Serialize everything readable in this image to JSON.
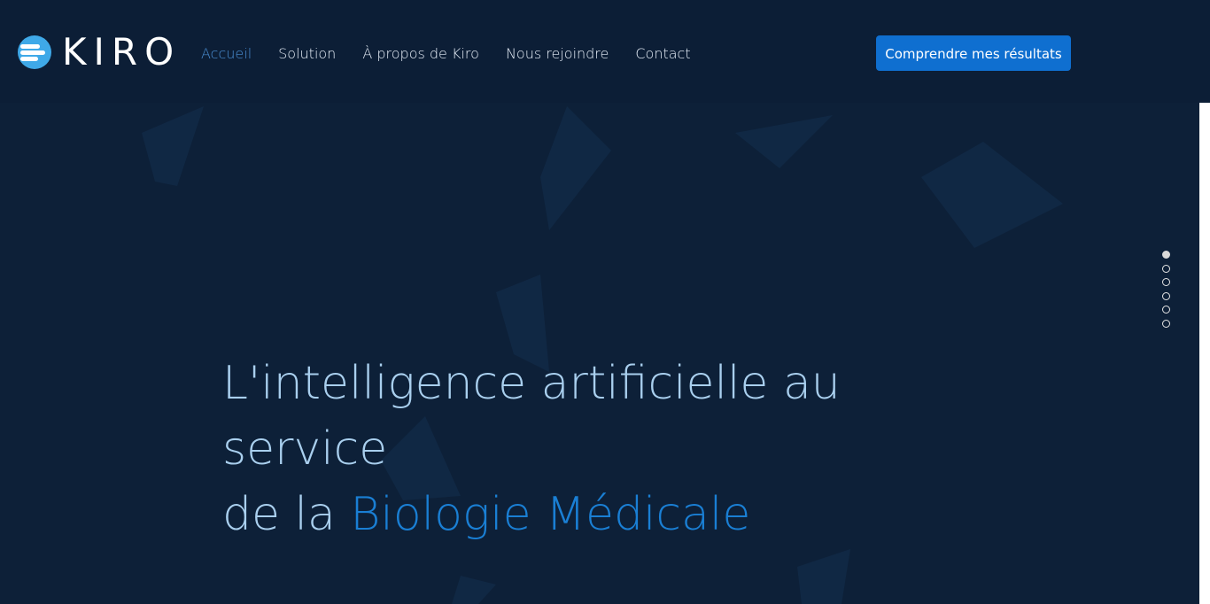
{
  "brand": {
    "name": "KIRO",
    "logo_icon": "kiro-logo-mark-icon"
  },
  "nav": {
    "items": [
      {
        "label": "Accueil",
        "active": true
      },
      {
        "label": "Solution",
        "active": false
      },
      {
        "label": "À propos de Kiro",
        "active": false
      },
      {
        "label": "Nous rejoindre",
        "active": false
      },
      {
        "label": "Contact",
        "active": false
      }
    ]
  },
  "header": {
    "cta_label": "Comprendre mes résultats"
  },
  "hero": {
    "title_line1": "L'intelligence artificielle au service",
    "title_line2_prefix": "de la ",
    "title_line2_accent": "Biologie Médicale"
  },
  "slider": {
    "dot_count": 6,
    "active_index": 0
  },
  "colors": {
    "background": "#0d2038",
    "header": "#0c1e36",
    "accent": "#1a7fd4",
    "cta": "#0f6fd0",
    "nav_active": "#4a8fd4",
    "hero_text": "#a9cfee"
  }
}
